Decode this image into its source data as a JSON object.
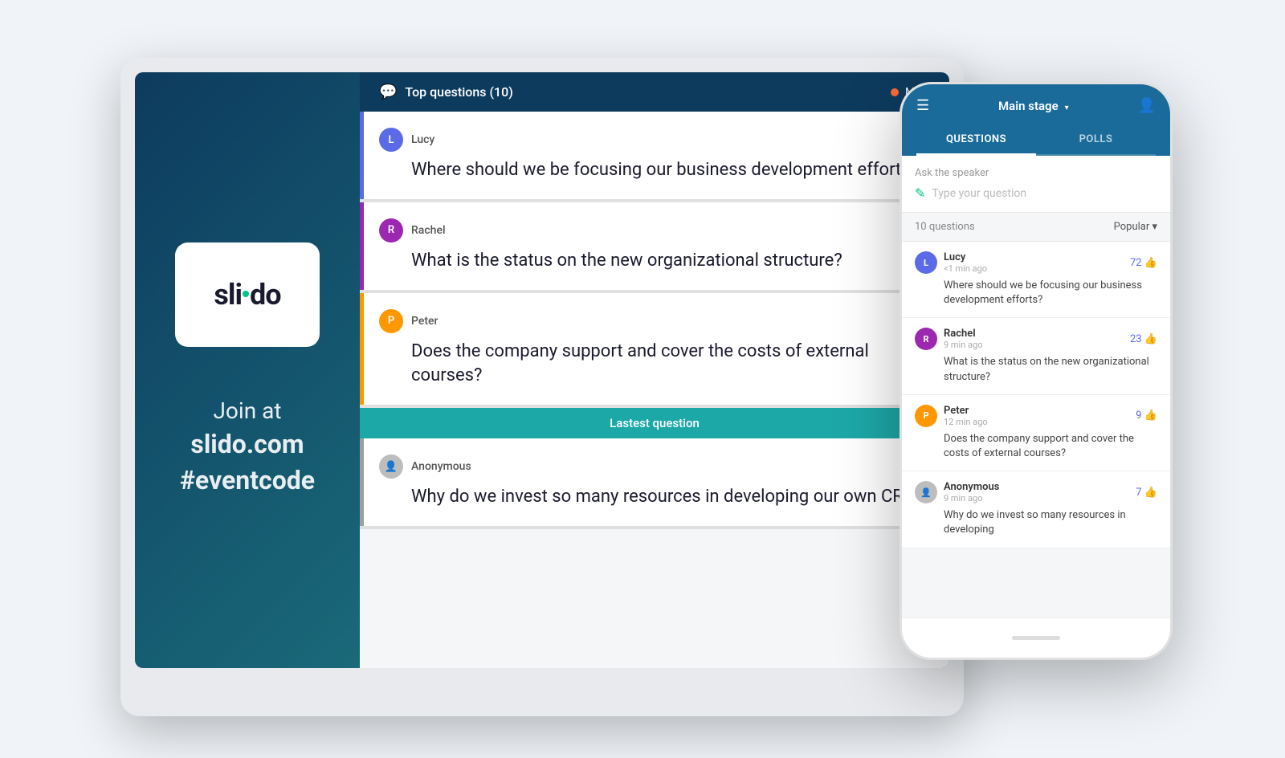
{
  "laptop": {
    "header": {
      "chat_icon": "💬",
      "title": "Top questions (10)",
      "dot_label": "Main",
      "dot_color": "#ff6b35"
    },
    "logo": {
      "text_before_dot": "sli",
      "text_after_dot": "do"
    },
    "join": {
      "line1": "Join at",
      "line2": "slido.com",
      "line3": "#eventcode"
    },
    "questions": [
      {
        "id": "lucy",
        "author": "Lucy",
        "avatar_initial": "L",
        "avatar_class": "lucy-av",
        "card_class": "lucy",
        "text": "Where should we be focusing our business development efforts?"
      },
      {
        "id": "rachel",
        "author": "Rachel",
        "avatar_initial": "R",
        "avatar_class": "rachel-av",
        "card_class": "rachel",
        "text": "What is the status on the new organizational structure?"
      },
      {
        "id": "peter",
        "author": "Peter",
        "avatar_initial": "P",
        "avatar_class": "peter-av",
        "card_class": "peter",
        "text": "Does the company support and cover the costs of external courses?"
      }
    ],
    "latest_banner": "Lastest question",
    "latest_question": {
      "id": "anon",
      "author": "Anonymous",
      "avatar_initial": "👤",
      "avatar_class": "anon-av",
      "card_class": "anon",
      "text": "Why do we invest so many resources in developing our own CRM?"
    }
  },
  "phone": {
    "header": {
      "stage_title": "Main stage",
      "stage_arrow": "▾"
    },
    "tabs": [
      {
        "label": "QUESTIONS",
        "active": true
      },
      {
        "label": "POLLS",
        "active": false
      }
    ],
    "ask_speaker": {
      "label": "Ask the speaker",
      "placeholder": "Type your question"
    },
    "questions_count": "10 questions",
    "sort_label": "Popular ▾",
    "questions": [
      {
        "author": "Lucy",
        "avatar_initial": "L",
        "avatar_color": "#5b6be8",
        "time": "<1 min ago",
        "likes": 72,
        "text": "Where should we be focusing our business development efforts?"
      },
      {
        "author": "Rachel",
        "avatar_initial": "R",
        "avatar_color": "#9c27b0",
        "time": "9 min ago",
        "likes": 23,
        "text": "What is the status on the new organizational structure?"
      },
      {
        "author": "Peter",
        "avatar_initial": "P",
        "avatar_color": "#ff9800",
        "time": "12 min ago",
        "likes": 9,
        "text": "Does the company support and cover the costs of external courses?"
      },
      {
        "author": "Anonymous",
        "avatar_initial": "👤",
        "avatar_color": "#bdbdbd",
        "time": "9 min ago",
        "likes": 7,
        "text": "Why do we invest so many resources in developing"
      }
    ]
  }
}
